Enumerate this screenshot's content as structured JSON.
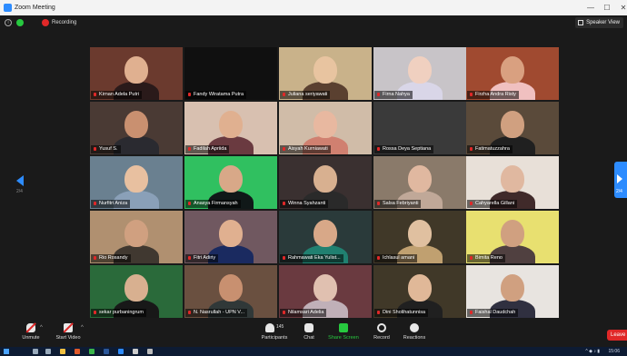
{
  "window": {
    "title": "Zoom Meeting",
    "min": "—",
    "max": "☐",
    "close": "✕"
  },
  "topbar": {
    "info_icon": "i",
    "recording_label": "Recording",
    "speaker_view_label": "Speaker View"
  },
  "pagination": {
    "current": "2/4",
    "next": "2/4"
  },
  "participants": [
    {
      "name": "Kirnan Adela Putri"
    },
    {
      "name": "Fandy Wiratama Putra"
    },
    {
      "name": "Juliana seriyawati"
    },
    {
      "name": "Firna Nahya"
    },
    {
      "name": "Firzha Andra Risty"
    },
    {
      "name": "Yusuf S."
    },
    {
      "name": "Fadilah Apriida"
    },
    {
      "name": "Aisyah Kurniawati"
    },
    {
      "name": "Rossa Deya Septiana"
    },
    {
      "name": "Fatimatuzzahra"
    },
    {
      "name": "Nurfitri Aniza"
    },
    {
      "name": "Anasya Firmansyah"
    },
    {
      "name": "Winna Syahzanti"
    },
    {
      "name": "Salsa Febriyanti"
    },
    {
      "name": "Cahyarella Gillani"
    },
    {
      "name": "Rio Rosandy"
    },
    {
      "name": "Fitri Adiriy"
    },
    {
      "name": "Rahmawati Eka Yulist..."
    },
    {
      "name": "Ichlasul amani"
    },
    {
      "name": "Bimita Reno"
    },
    {
      "name": "sekar purbaningrum"
    },
    {
      "name": "N. Nasrullah - UPN V..."
    },
    {
      "name": "Nilamsari Adelia"
    },
    {
      "name": "Dini Sholihatunnisa"
    },
    {
      "name": "Faishal Daudchah"
    }
  ],
  "toolbar": {
    "unmute": "Unmute",
    "start_video": "Start Video",
    "participants_count": "145",
    "participants": "Participants",
    "chat": "Chat",
    "share_screen": "Share Screen",
    "record": "Record",
    "reactions": "Reactions",
    "leave": "Leave"
  },
  "taskbar": {
    "clock": "15:06"
  },
  "colors": {
    "accent": "#2d8cff",
    "danger": "#e02828",
    "success": "#27c93f"
  }
}
